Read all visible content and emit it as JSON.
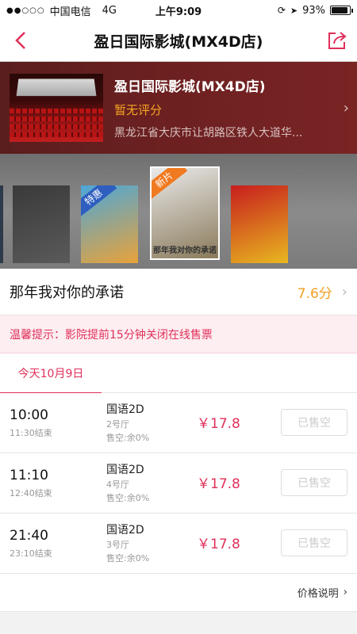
{
  "status_bar": {
    "signal": "●●○○○",
    "carrier": "中国电信",
    "network": "4G",
    "time": "上午9:09",
    "battery": "93%",
    "battery_level": 0.93
  },
  "nav": {
    "title": "盈日国际影城(MX4D店)"
  },
  "cinema": {
    "name": "盈日国际影城(MX4D店)",
    "rating": "暂无评分",
    "address": "黑龙江省大庆市让胡路区铁人大道华..."
  },
  "posters": [
    {
      "tag": "",
      "title": "",
      "colors": [
        "#3a3a3a",
        "#5a5a5a"
      ]
    },
    {
      "tag": "特惠",
      "title": "",
      "colors": [
        "#4da7d8",
        "#e8a23a"
      ]
    },
    {
      "tag": "新片",
      "title": "那年我对你的承诺",
      "colors": [
        "#e9e9e9",
        "#8a7a5a"
      ]
    },
    {
      "tag": "",
      "title": "",
      "colors": [
        "#c71d1d",
        "#e8b820"
      ]
    }
  ],
  "movie": {
    "title": "那年我对你的承诺",
    "score": "7.6分"
  },
  "notice": "温馨提示：影院提前15分钟关闭在线售票",
  "date_tab": "今天10月9日",
  "showtimes": [
    {
      "time": "10:00",
      "end": "11:30结束",
      "lang": "国语2D",
      "hall": "2号厅",
      "seats": "售空:余0%",
      "price": "￥17.8",
      "button": "已售空"
    },
    {
      "time": "11:10",
      "end": "12:40结束",
      "lang": "国语2D",
      "hall": "4号厅",
      "seats": "售空:余0%",
      "price": "￥17.8",
      "button": "已售空"
    },
    {
      "time": "21:40",
      "end": "23:10结束",
      "lang": "国语2D",
      "hall": "3号厅",
      "seats": "售空:余0%",
      "price": "￥17.8",
      "button": "已售空"
    }
  ],
  "price_desc": "价格说明",
  "colors": {
    "accent": "#e0305a",
    "score": "#f0a020",
    "rating": "#f5a623"
  }
}
